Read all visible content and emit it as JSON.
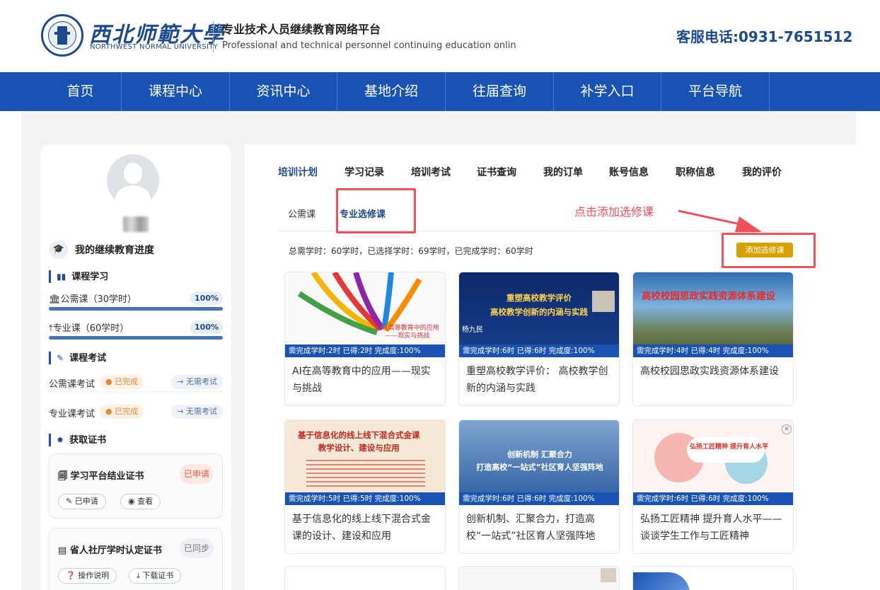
{
  "header": {
    "university_cn": "西北师範大學",
    "university_en": "NORTHWEST NORMAL UNIVERSITY",
    "platform_cn": "专业技术人员继续教育网络平台",
    "platform_en": "Professional and technical personnel continuing education onlin",
    "hotline": "客服电话:0931-7651512"
  },
  "nav": {
    "items": [
      "首页",
      "课程中心",
      "资讯中心",
      "基地介绍",
      "往届查询",
      "补学入口",
      "平台导航"
    ]
  },
  "sidebar": {
    "progress_title": "我的继续教育进度",
    "course_section": "课程学习",
    "courses": [
      {
        "label": "公需课（30学时）",
        "percent_label": "100%",
        "progress": 1.0
      },
      {
        "label": "专业课（60学时）",
        "percent_label": "100%",
        "progress": 1.0
      }
    ],
    "exam_section": "课程考试",
    "exams": [
      {
        "label": "公需课考试",
        "status": "● 已完成",
        "action": "→ 无需考试"
      },
      {
        "label": "专业课考试",
        "status": "● 已完成",
        "action": "→ 无需考试"
      }
    ],
    "cert_section": "获取证书",
    "certs": [
      {
        "name": "学习平台结业证书",
        "badge": "已申请",
        "btn1": "已申请",
        "btn2": "查看"
      },
      {
        "name": "省人社厅学时认定证书",
        "badge": "已同步",
        "btn1": "操作说明",
        "btn2": "下载证书"
      }
    ]
  },
  "tabs": [
    "培训计划",
    "学习记录",
    "培训考试",
    "证书查询",
    "我的订单",
    "账号信息",
    "职称信息",
    "我的评价"
  ],
  "subtabs": [
    "公需课",
    "专业选修课"
  ],
  "summary": "总需学时：60学时，已选择学时：69学时，已完成学时：60学时",
  "add_button": "添加选修课",
  "callout": "点击添加选修课",
  "cards": [
    {
      "strip": "需完成学时:2时 已得:2时 完成度:100%",
      "title": "AI在高等教育中的应用——现实与挑战",
      "thumb_text": "AI在高等教育中的应用\n——现实与挑战"
    },
    {
      "strip": "需完成学时:6时 已得:6时 完成度:100%",
      "title": "重塑高校教学评价： 高校教学创新的内涵与实践",
      "thumb_text": "重塑高校教学评价\n高校教学创新的内涵与实践",
      "thumb_name": "杨九民"
    },
    {
      "strip": "需完成学时:4时 已得:4时 完成度:100%",
      "title": "高校校园思政实践资源体系建设",
      "thumb_text": "高校校园思政实践资源体系建设"
    },
    {
      "strip": "需完成学时:5时 已得:5时 完成度:100%",
      "title": "基于信息化的线上线下混合式金课的设计、建设和应用",
      "thumb_text": "基于信息化的线上线下混合式金课\n教学设计、建设与应用"
    },
    {
      "strip": "需完成学时:6时 已得:6时 完成度:100%",
      "title": "创新机制、汇聚合力，打造高校“一站式”社区育人坚强阵地",
      "thumb_text": "创新机制 汇聚合力\n打造高校“一站式”社区育人坚强阵地"
    },
    {
      "strip": "需完成学时:6时 已得:6时 完成度:100%",
      "title": "弘扬工匠精神 提升育人水平——谈谈学生工作与工匠精神",
      "thumb_text": "弘扬工匠精神 提升育人水平"
    }
  ]
}
